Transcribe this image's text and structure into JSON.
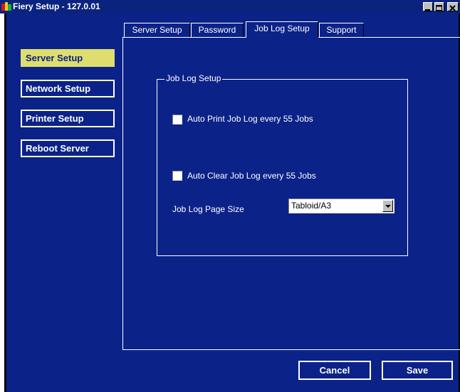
{
  "window": {
    "title": "Fiery Setup - 127.0.01"
  },
  "tabs": [
    {
      "label": "Server Setup"
    },
    {
      "label": "Password"
    },
    {
      "label": "Job Log Setup"
    },
    {
      "label": "Support"
    }
  ],
  "active_tab": "Job Log Setup",
  "nav": {
    "items": [
      {
        "label": "Server Setup",
        "selected": true
      },
      {
        "label": "Network Setup",
        "selected": false
      },
      {
        "label": "Printer Setup",
        "selected": false
      },
      {
        "label": "Reboot Server",
        "selected": false
      }
    ]
  },
  "job_log": {
    "group_title": "Job Log Setup",
    "auto_print_label": "Auto Print Job Log every 55 Jobs",
    "auto_print_checked": false,
    "auto_clear_label": "Auto Clear Job Log every 55 Jobs",
    "auto_clear_checked": false,
    "page_size_label": "Job Log Page Size",
    "page_size_value": "Tabloid/A3"
  },
  "actions": {
    "cancel_label": "Cancel",
    "save_label": "Save"
  },
  "colors": {
    "background": "#0b2288",
    "selected_nav": "#dedd6e",
    "titlebar": "#0a237e"
  },
  "icons": {
    "app": "fiery-app-icon",
    "minimize": "minimize-icon",
    "maximize": "maximize-icon",
    "close": "close-icon",
    "dropdown": "chevron-down-icon"
  }
}
